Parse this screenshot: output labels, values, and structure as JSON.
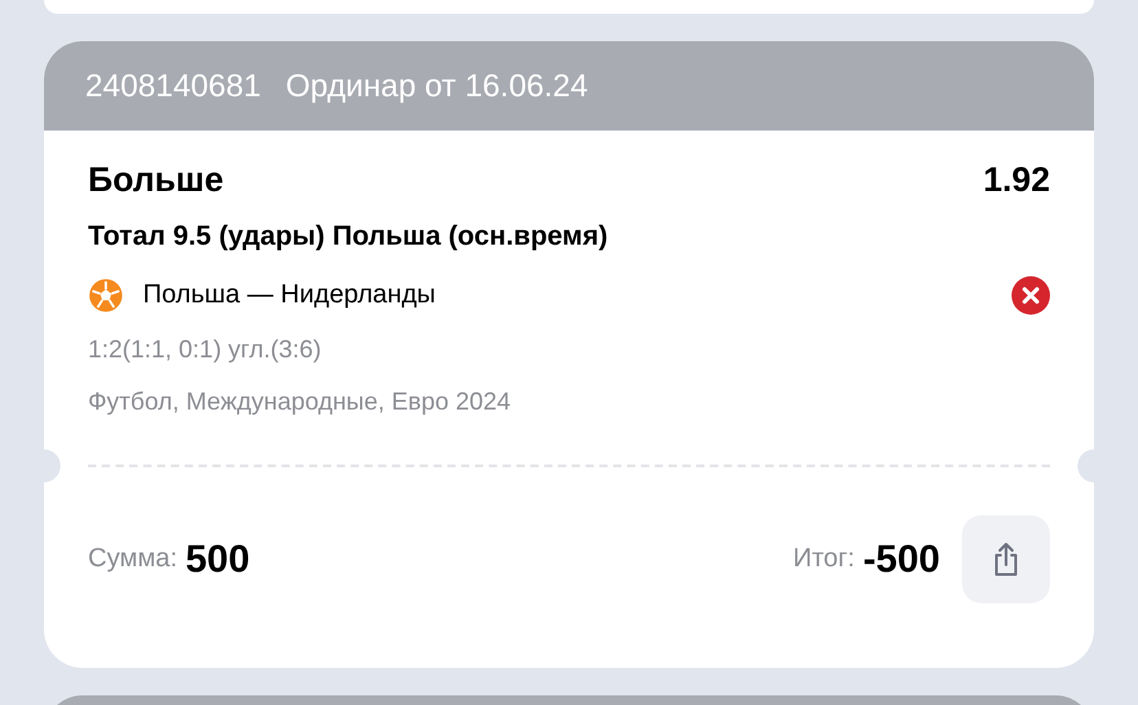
{
  "bet": {
    "number": "2408140681",
    "type_label": "Ординар от 16.06.24",
    "outcome": "Больше",
    "odds": "1.92",
    "market": "Тотал 9.5 (удары) Польша (осн.время)",
    "event": "Польша — Нидерланды",
    "lost": true,
    "score": "1:2(1:1, 0:1) угл.(3:6)",
    "tournament": "Футбол, Международные, Евро 2024",
    "stake_label": "Сумма:",
    "stake": "500",
    "total_label": "Итог:",
    "total": "-500"
  }
}
